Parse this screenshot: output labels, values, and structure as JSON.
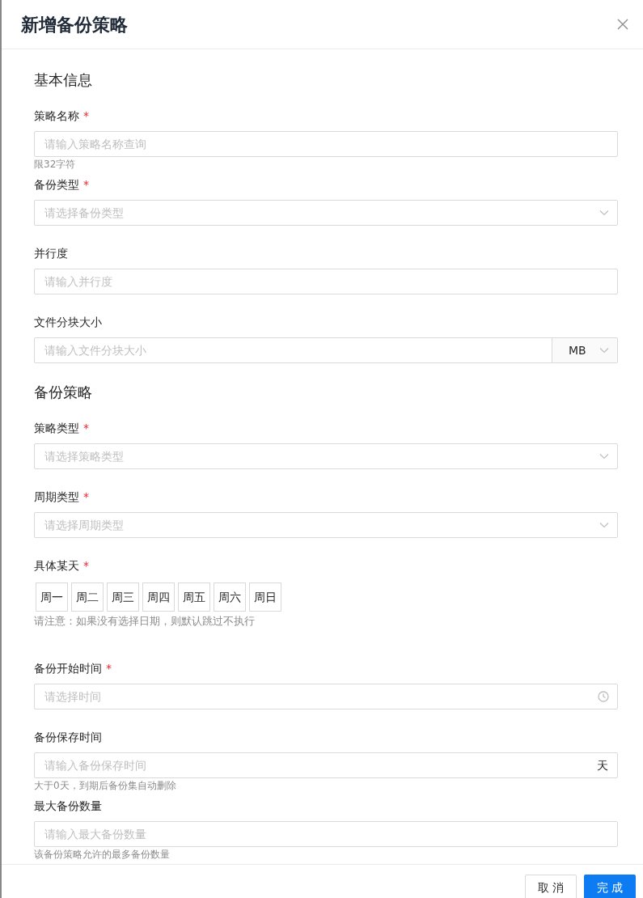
{
  "dialog": {
    "title": "新增备份策略"
  },
  "sections": [
    {
      "title": "基本信息",
      "fields": [
        {
          "kind": "text",
          "label": "策略名称",
          "required_mark": "*",
          "placeholder": "请输入策略名称查询",
          "hint": "限32字符"
        },
        {
          "kind": "select",
          "label": "备份类型",
          "required_mark": "*",
          "placeholder": "请选择备份类型"
        },
        {
          "kind": "text",
          "label": "并行度",
          "placeholder": "请输入并行度"
        },
        {
          "kind": "unit-select",
          "label": "文件分块大小",
          "placeholder": "请输入文件分块大小",
          "unit": "MB"
        }
      ]
    },
    {
      "title": "备份策略",
      "fields": [
        {
          "kind": "select",
          "label": "策略类型",
          "required_mark": "*",
          "placeholder": "请选择策略类型"
        },
        {
          "kind": "select",
          "label": "周期类型",
          "required_mark": "*",
          "placeholder": "请选择周期类型"
        },
        {
          "kind": "days",
          "label": "具体某天",
          "required_mark": "*",
          "days": [
            {
              "label": "周一",
              "selected": false
            },
            {
              "label": "周二",
              "selected": false
            },
            {
              "label": "周三",
              "selected": false
            },
            {
              "label": "周四",
              "selected": false
            },
            {
              "label": "周五",
              "selected": false
            },
            {
              "label": "周六",
              "selected": false
            },
            {
              "label": "周日",
              "selected": false
            }
          ],
          "note": "请注意：如果没有选择日期，则默认跳过不执行"
        },
        {
          "kind": "time",
          "label": "备份开始时间",
          "required_mark": "*",
          "placeholder": "请选择时间"
        },
        {
          "kind": "suffix",
          "label": "备份保存时间",
          "placeholder": "请输入备份保存时间",
          "suffix": "天",
          "hint": "大于0天，到期后备份集自动删除"
        },
        {
          "kind": "text",
          "label": "最大备份数量",
          "placeholder": "请输入最大备份数量",
          "hint": "该备份策略允许的最多备份数量"
        }
      ]
    }
  ],
  "footer": {
    "buttons": [
      {
        "label": "取消",
        "kind": "secondary"
      },
      {
        "label": "完成",
        "kind": "primary"
      }
    ]
  }
}
